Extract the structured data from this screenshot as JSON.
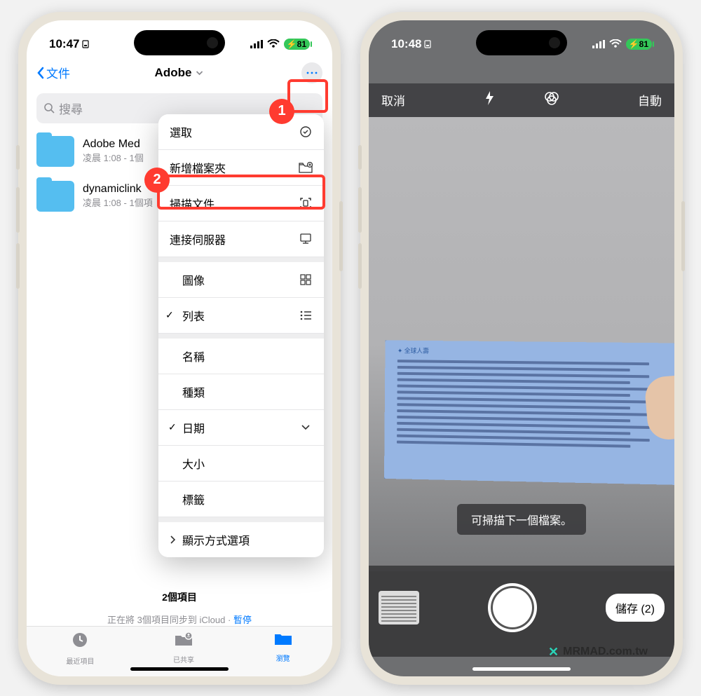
{
  "left": {
    "status": {
      "time": "10:47",
      "battery": "81"
    },
    "nav": {
      "back": "文件",
      "title": "Adobe"
    },
    "search_placeholder": "搜尋",
    "folders": [
      {
        "name": "Adobe Med",
        "meta": "凌晨 1:08 - 1個"
      },
      {
        "name": "dynamiclink",
        "meta": "凌晨 1:08 - 1個項"
      }
    ],
    "menu": {
      "select": "選取",
      "new_folder": "新增檔案夾",
      "scan_doc": "掃描文件",
      "connect_server": "連接伺服器",
      "view_grid": "圖像",
      "view_list": "列表",
      "sort_name": "名稱",
      "sort_kind": "種類",
      "sort_date": "日期",
      "sort_size": "大小",
      "sort_tag": "標籤",
      "display_opts": "顯示方式選項"
    },
    "item_count": "2個項目",
    "sync_text": "正在將 3個項目同步到 iCloud · ",
    "sync_pause": "暫停",
    "tabs": {
      "recent": "最近項目",
      "shared": "已共享",
      "browse": "瀏覽"
    },
    "callout1": "1",
    "callout2": "2"
  },
  "right": {
    "status": {
      "time": "10:48",
      "battery": "81"
    },
    "scan": {
      "cancel": "取消",
      "auto": "自動",
      "toast": "可掃描下一個檔案。",
      "save": "儲存 (2)"
    }
  },
  "watermark": "MRMAD.com.tw"
}
